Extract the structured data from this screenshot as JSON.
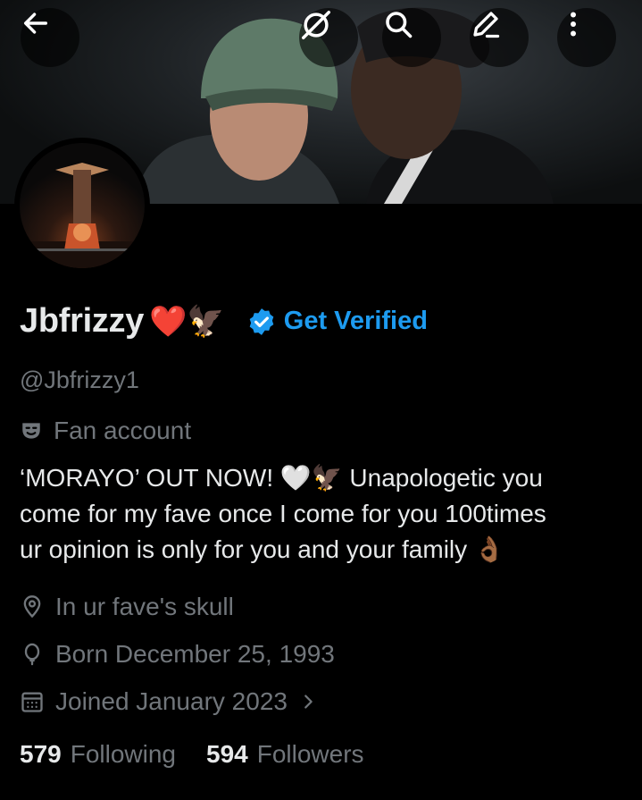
{
  "header": {
    "back_icon": "arrow-left-icon",
    "grok_icon": "grok-icon",
    "search_icon": "search-icon",
    "edit_icon": "pencil-icon",
    "more_icon": "more-vertical-icon"
  },
  "banner": {
    "description_icon": "banner-photo"
  },
  "profile": {
    "display_name": "Jbfrizzy",
    "name_emojis": "❤️🦅",
    "get_verified_label": "Get Verified",
    "handle": "@Jbfrizzy1",
    "category": "Fan account",
    "bio_line1": "‘MORAYO’ OUT NOW! 🤍🦅  Unapologetic you",
    "bio_line2": "come for my fave once I come for you 100times",
    "bio_line3": "ur opinion is only for you and your family 👌🏾",
    "location": "In ur fave's skull",
    "birthday": "Born December 25, 1993",
    "joined": "Joined January 2023"
  },
  "stats": {
    "following_count": "579",
    "following_label": "Following",
    "followers_count": "594",
    "followers_label": "Followers"
  },
  "colors": {
    "accent": "#1d9bf0",
    "muted": "#71767b",
    "text": "#e7e9ea",
    "background": "#000000"
  }
}
